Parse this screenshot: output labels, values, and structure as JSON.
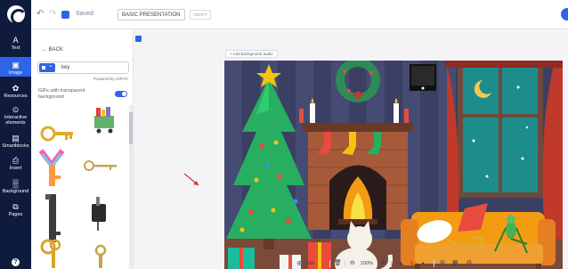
{
  "rail": {
    "items": [
      {
        "label": "Text",
        "glyph": "A"
      },
      {
        "label": "Image",
        "glyph": "▣"
      },
      {
        "label": "Resources",
        "glyph": "✿"
      },
      {
        "label": "Interactive elements",
        "glyph": "⊙"
      },
      {
        "label": "Smartblocks",
        "glyph": "▤"
      },
      {
        "label": "Insert",
        "glyph": "⎙"
      },
      {
        "label": "Background",
        "glyph": "▒"
      },
      {
        "label": "Pages",
        "glyph": "⧉"
      }
    ],
    "help": "?"
  },
  "topbar": {
    "undo": "↶",
    "redo": "↷",
    "saved_label": "Saved",
    "title_value": "BASIC PRESENTATION",
    "draft_label": "DRAFT"
  },
  "panel": {
    "back_label": "← BACK",
    "search_value": "key",
    "powered_by": "Powered by  GIPHY",
    "gif_toggle_label": "GIFs with transparent background"
  },
  "stage": {
    "add_audio_label": "+  Add background audio"
  },
  "bottombar": {
    "add_page": "Add page",
    "zoom": "100%",
    "page_number": "1"
  },
  "colors": {
    "accent": "#2f64e6",
    "rail": "#0f1b3d"
  }
}
